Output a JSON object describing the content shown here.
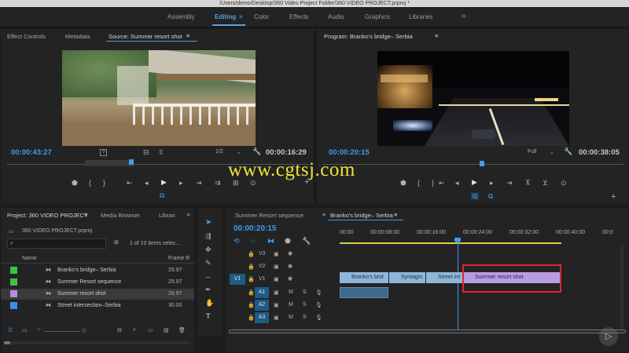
{
  "window": {
    "title": "/Users/demo/Desktop/360 Video Project Folder/360 VIDEO PROJECT.prproj *"
  },
  "workspaces": [
    "Assembly",
    "Editing",
    "Color",
    "Effects",
    "Audio",
    "Graphics",
    "Libraries"
  ],
  "active_workspace": "Editing",
  "source_panel": {
    "tabs": [
      "Effect Controls",
      "Metadata",
      "Source: Summer resort shot"
    ],
    "timecode_in": "00:00:43:27",
    "timecode_duration": "00:00:16:29",
    "resolution": "1/2"
  },
  "program_panel": {
    "tab": "Program: Branko's bridge– Serbia",
    "timecode_in": "00:00:20:15",
    "timecode_duration": "00:00:38:05",
    "resolution": "Full"
  },
  "watermark": "www.cgtsj.com",
  "project_panel": {
    "tabs": [
      "Project: 360 VIDEO PROJECT",
      "Media Browser",
      "Librari"
    ],
    "project_file": "360 VIDEO PROJECT.prproj",
    "items_count": "1 of 10 items selec...",
    "col_name": "Name",
    "col_frame": "Frame R",
    "items": [
      {
        "name": "Branko's bridge– Serbia",
        "fps": "29.97",
        "color": "#3fbf4a"
      },
      {
        "name": "Summer Resort sequence",
        "fps": "29.97",
        "color": "#3fbf4a"
      },
      {
        "name": "Summer resort shot",
        "fps": "29.97",
        "color": "#b48fd6"
      },
      {
        "name": "Street intersection–Serbia",
        "fps": "30.00",
        "color": "#3a8fe0"
      }
    ]
  },
  "timeline": {
    "tabs": [
      "Summer Resort sequence",
      "Branko's bridge– Serbia"
    ],
    "timecode": "00:00:20:15",
    "ruler": [
      "00:00",
      "00:00:08:00",
      "00:00:16:00",
      "00:00:24:00",
      "00:00:32:00",
      "00:00:40:00",
      "00:0"
    ],
    "video_tracks": [
      "V3",
      "V2",
      "V1"
    ],
    "audio_tracks": [
      "A1",
      "A2",
      "A3"
    ],
    "source_v": "V1",
    "m_label": "M",
    "s_label": "S",
    "clips": [
      {
        "name": "Branko's brid"
      },
      {
        "name": "Syntagm"
      },
      {
        "name": "Street int"
      },
      {
        "name": "Summer resort shot"
      }
    ]
  },
  "colors": {
    "accent": "#3d9ef0",
    "selection": "#e0262b",
    "clip_video": "#8fb6d9",
    "clip_highlight": "#b79ce0"
  }
}
